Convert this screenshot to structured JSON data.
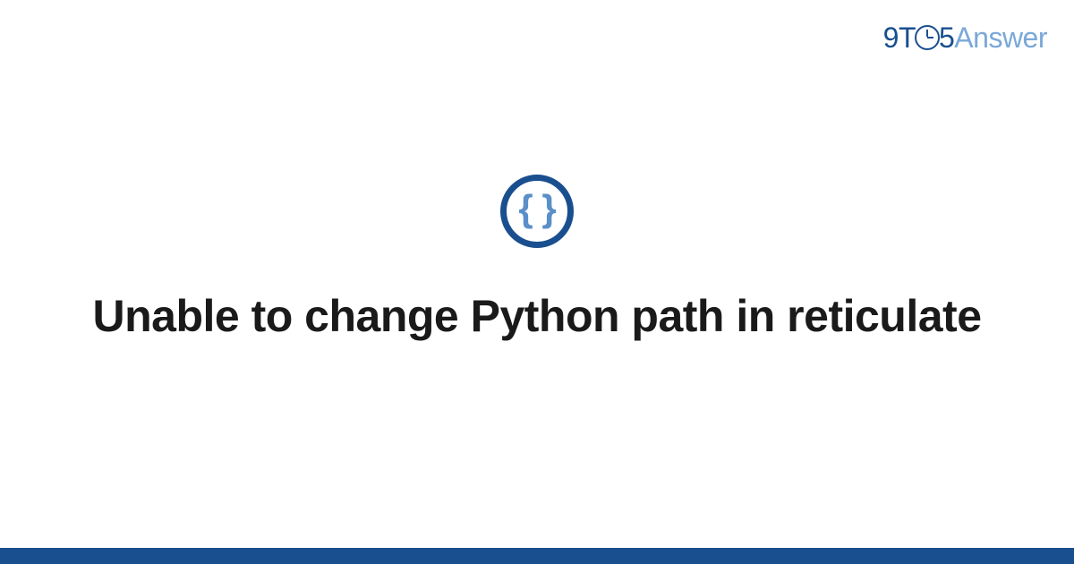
{
  "logo": {
    "part1": "9T",
    "part2": "5",
    "part3": "Answer"
  },
  "icon": {
    "glyph": "{ }",
    "semantic": "code-braces-icon"
  },
  "title": "Unable to change Python path in reticulate",
  "colors": {
    "brand_dark": "#1a4f8f",
    "brand_light": "#7aa8d8",
    "icon_inner": "#5a8fc9",
    "text": "#1a1a1a"
  }
}
